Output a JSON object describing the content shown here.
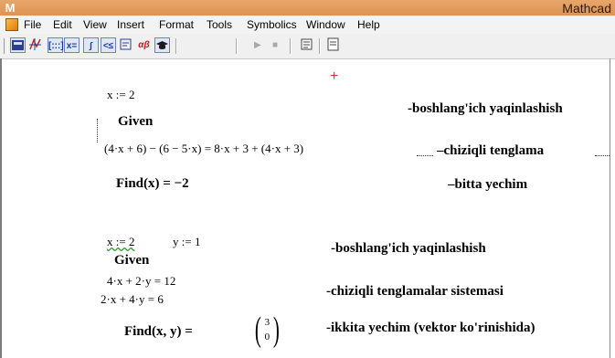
{
  "titlebar": {
    "app_icon": "M",
    "title": "Mathcad"
  },
  "menu": {
    "items": [
      "File",
      "Edit",
      "View",
      "Insert",
      "Format",
      "Tools",
      "Symbolics",
      "Window",
      "Help"
    ]
  },
  "toolbar": {
    "icons": [
      "calculator-icon",
      "graph-icon",
      "matrix-icon",
      "evaluation-icon",
      "calculus-icon",
      "boolean-icon",
      "programming-icon",
      "greek-icon",
      "symbolic-icon",
      "play-icon",
      "stop-icon",
      "component-icon",
      "resource-icon"
    ],
    "matrix_glyph": "[:::]",
    "eval_glyph": "x=",
    "calculus_glyph": "∫",
    "boolean_glyph": "<≤",
    "greek_glyph": "αβ"
  },
  "worksheet": {
    "block1": {
      "initial_x": "x := 2",
      "given": "Given",
      "equation": "(4·x + 6) − (6 − 5·x) = 8·x + 3 + (4·x + 3)",
      "find": "Find(x) = −2",
      "comment_initial": "-boshlang'ich yaqinlashish",
      "comment_equation": "–chiziqli tenglama",
      "comment_result": "–bitta yechim"
    },
    "block2": {
      "initial_x": "x := 2",
      "initial_y": "y := 1",
      "given": "Given",
      "eq1": "4·x + 2·y = 12",
      "eq2": "2·x + 4·y = 6",
      "find": "Find(x, y) =",
      "result_vector": [
        "3",
        "0"
      ],
      "comment_initial": "-boshlang'ich yaqinlashish",
      "comment_system": "-chiziqli tenglamalar sistemasi",
      "comment_result": "-ikkita yechim (vektor ko'rinishida)"
    }
  }
}
